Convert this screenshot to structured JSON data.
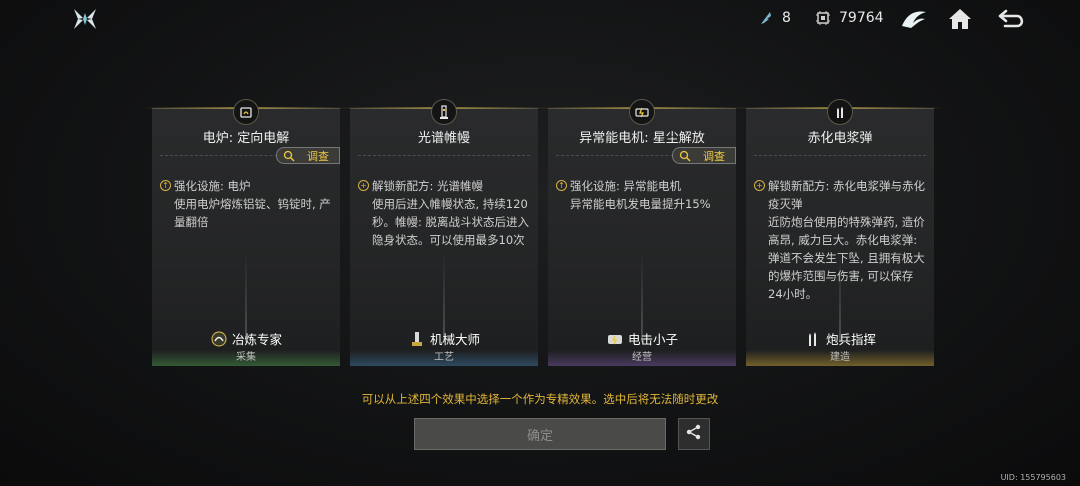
{
  "header": {
    "resource_a": {
      "icon": "feather-icon",
      "value": "8"
    },
    "resource_b": {
      "icon": "chip-icon",
      "value": "79764"
    },
    "buttons": [
      "wing-icon",
      "home-icon",
      "back-icon"
    ]
  },
  "cards": [
    {
      "title": "电炉: 定向电解",
      "survey_label": "调查",
      "effect_head": "强化设施: 电炉",
      "effect_body": "使用电炉熔炼铝锭、钨锭时, 产量翻倍",
      "talent": "冶炼专家",
      "category": "采集"
    },
    {
      "title": "光谱帷幔",
      "effect_head": "解锁新配方: 光谱帷幔",
      "effect_body": "使用后进入帷幔状态, 持续120秒。帷幔: 脱离战斗状态后进入隐身状态。可以使用最多10次",
      "talent": "机械大师",
      "category": "工艺"
    },
    {
      "title": "异常能电机: 星尘解放",
      "survey_label": "调查",
      "effect_head": "强化设施: 异常能电机",
      "effect_body": "异常能电机发电量提升15%",
      "talent": "电击小子",
      "category": "经营"
    },
    {
      "title": "赤化电浆弹",
      "effect_head": "解锁新配方: 赤化电浆弹与赤化疫灭弹",
      "effect_body": "近防炮台使用的特殊弹药, 造价高昂, 威力巨大。赤化电浆弹: 弹道不会发生下坠, 且拥有极大的爆炸范围与伤害, 可以保存24小时。",
      "talent": "炮兵指挥",
      "category": "建造"
    }
  ],
  "instruction": "可以从上述四个效果中选择一个作为专精效果。选中后将无法随时更改",
  "confirm_label": "确定",
  "uid": "UID: 155795603",
  "colors": {
    "accent_gold": "#e0b63a",
    "survey_text": "#f0c840"
  }
}
